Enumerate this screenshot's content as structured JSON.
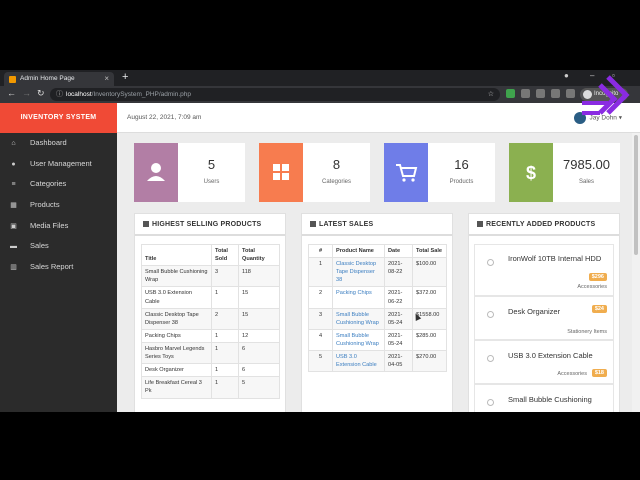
{
  "browser": {
    "tab_title": "Admin Home Page",
    "tab_close": "×",
    "new_tab": "+",
    "url_host": "localhost",
    "url_path": "/InventorySystem_PHP/admin.php",
    "profile_label": "Incognito",
    "back_icon": "arrow-left-icon",
    "forward_icon": "arrow-right-icon",
    "reload_icon": "reload-icon"
  },
  "app": {
    "brand": "INVENTORY SYSTEM",
    "date": "August 22, 2021, 7:09 am",
    "user": "Jay Dohn",
    "accent": "#f04a36"
  },
  "sidebar": {
    "items": [
      {
        "label": "Dashboard",
        "icon": "home-icon",
        "glyph": "⌂"
      },
      {
        "label": "User Management",
        "icon": "user-icon",
        "glyph": "●"
      },
      {
        "label": "Categories",
        "icon": "list-icon",
        "glyph": "≡"
      },
      {
        "label": "Products",
        "icon": "grid-icon",
        "glyph": "▦"
      },
      {
        "label": "Media Files",
        "icon": "image-icon",
        "glyph": "▣"
      },
      {
        "label": "Sales",
        "icon": "credit-card-icon",
        "glyph": "▬"
      },
      {
        "label": "Sales Report",
        "icon": "bar-chart-icon",
        "glyph": "▥"
      }
    ]
  },
  "stats": [
    {
      "value": "5",
      "label": "Users",
      "color": "#b27ea5",
      "icon": "user-icon"
    },
    {
      "value": "8",
      "label": "Categories",
      "color": "#f77c4f",
      "icon": "grid-icon"
    },
    {
      "value": "16",
      "label": "Products",
      "color": "#6f7de8",
      "icon": "cart-icon"
    },
    {
      "value": "7985.00",
      "label": "Sales",
      "color": "#8bb050",
      "icon": "dollar-icon"
    }
  ],
  "highest": {
    "title": "HIGHEST SELLING PRODUCTS",
    "headers": [
      "Title",
      "Total Sold",
      "Total Quantity"
    ],
    "rows": [
      [
        "Small Bubble Cushioning Wrap",
        "3",
        "118"
      ],
      [
        "USB 3.0 Extension Cable",
        "1",
        "15"
      ],
      [
        "Classic Desktop Tape Dispenser 38",
        "2",
        "15"
      ],
      [
        "Packing Chips",
        "1",
        "12"
      ],
      [
        "Hasbro Marvel Legends Series Toys",
        "1",
        "6"
      ],
      [
        "Desk Organizer",
        "1",
        "6"
      ],
      [
        "Life Breakfast Cereal 3 Pk",
        "1",
        "5"
      ]
    ]
  },
  "latest": {
    "title": "LATEST SALES",
    "headers": [
      "#",
      "Product Name",
      "Date",
      "Total Sale"
    ],
    "rows": [
      [
        "1",
        "Classic Desktop Tape Dispenser 38",
        "2021-08-22",
        "$100.00"
      ],
      [
        "2",
        "Packing Chips",
        "2021-06-22",
        "$372.00"
      ],
      [
        "3",
        "Small Bubble Cushioning Wrap",
        "2021-05-24",
        "$1558.00"
      ],
      [
        "4",
        "Small Bubble Cushioning Wrap",
        "2021-05-24",
        "$285.00"
      ],
      [
        "5",
        "USB 3.0 Extension Cable",
        "2021-04-05",
        "$270.00"
      ]
    ]
  },
  "recent": {
    "title": "RECENTLY ADDED PRODUCTS",
    "items": [
      {
        "name": "IronWolf 10TB Internal HDD",
        "price": "$296",
        "category": "Accessories"
      },
      {
        "name": "Desk Organizer",
        "price": "$24",
        "category": "Stationery Items"
      },
      {
        "name": "USB 3.0 Extension Cable",
        "price": "$18",
        "category": "Accessories"
      },
      {
        "name": "Small Bubble Cushioning",
        "price": "",
        "category": ""
      }
    ]
  }
}
